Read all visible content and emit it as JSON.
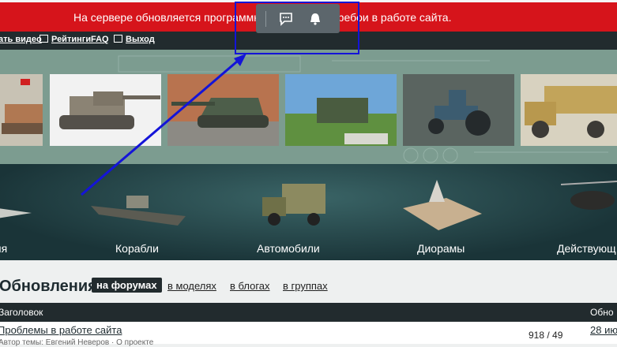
{
  "alert": {
    "text": "На сервере обновляется программно Возможны перебои в работе сайта."
  },
  "nav": {
    "items": [
      {
        "label": "ать видео"
      },
      {
        "label": "Рейтинги"
      },
      {
        "label": "FAQ"
      },
      {
        "label": "Выход"
      }
    ]
  },
  "floatbar": {
    "icons": [
      "chat-icon",
      "bell-icon"
    ]
  },
  "categories": [
    {
      "label": "яя"
    },
    {
      "label": "Корабли"
    },
    {
      "label": "Автомобили"
    },
    {
      "label": "Диорамы"
    },
    {
      "label": "Действующ"
    }
  ],
  "updates": {
    "heading": "Обновления",
    "tabs": [
      "на форумах",
      "в моделях",
      "в блогах",
      "в группах"
    ],
    "active_tab": "на форумах"
  },
  "table": {
    "headers": {
      "title": "Заголовок",
      "last": "Обно"
    },
    "rows": [
      {
        "title": "Проблемы в работе сайта",
        "subtitle": "Автор темы: Евгений Неверов · О проекте",
        "count": "918 / 49",
        "last": "28 ию"
      }
    ]
  },
  "colors": {
    "alert": "#d6141b",
    "nav": "#222b2e",
    "highlight": "#1414d8"
  }
}
